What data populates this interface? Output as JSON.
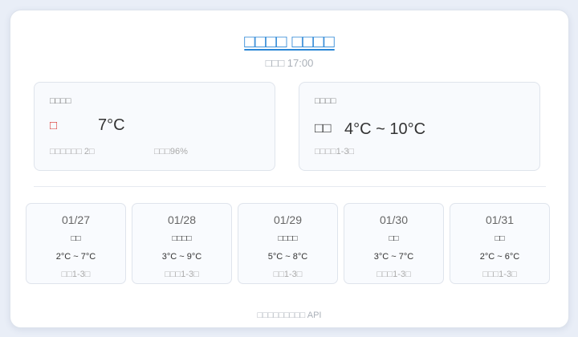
{
  "header": {
    "title": "□□□□ □□□□",
    "update_time": "□□□ 17:00"
  },
  "current": {
    "label": "□□□□",
    "icon": "□",
    "temperature": "7°C",
    "feels_like": "□□□□□□ 2□",
    "humidity": "□□□96%"
  },
  "today": {
    "label": "□□□□",
    "icon": "□□",
    "temperature_range": "4°C ~ 10°C",
    "wind": "□□□□1-3□"
  },
  "forecast": [
    {
      "date": "01/27",
      "condition": "□□",
      "temp": "2°C ~ 7°C",
      "wind": "□□1-3□"
    },
    {
      "date": "01/28",
      "condition": "□□□□",
      "temp": "3°C ~ 9°C",
      "wind": "□□□1-3□"
    },
    {
      "date": "01/29",
      "condition": "□□□□",
      "temp": "5°C ~ 8°C",
      "wind": "□□1-3□"
    },
    {
      "date": "01/30",
      "condition": "□□",
      "temp": "3°C ~ 7°C",
      "wind": "□□□1-3□"
    },
    {
      "date": "01/31",
      "condition": "□□",
      "temp": "2°C ~ 6°C",
      "wind": "□□□1-3□"
    }
  ],
  "footer": {
    "source": "□□□□□□□□□ API"
  },
  "colors": {
    "title": "#2a86d6",
    "current_icon": "#d9302a"
  }
}
